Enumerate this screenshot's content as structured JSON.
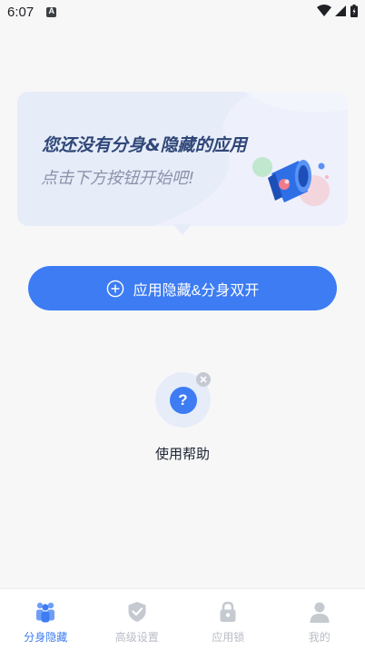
{
  "status_bar": {
    "time": "6:07"
  },
  "promo": {
    "title": "您还没有分身&隐藏的应用",
    "subtitle": "点击下方按钮开始吧!"
  },
  "primary_action": {
    "label": "应用隐藏&分身双开"
  },
  "help": {
    "label": "使用帮助",
    "icon_text": "?"
  },
  "bottom_nav": {
    "items": [
      {
        "label": "分身隐藏",
        "icon": "people-icon",
        "active": true
      },
      {
        "label": "高级设置",
        "icon": "shield-check-icon",
        "active": false
      },
      {
        "label": "应用锁",
        "icon": "lock-icon",
        "active": false
      },
      {
        "label": "我的",
        "icon": "person-icon",
        "active": false
      }
    ]
  },
  "colors": {
    "accent": "#3d7cf3",
    "inactive": "#b8bcc4",
    "card_bg": "#e7ecf9"
  }
}
